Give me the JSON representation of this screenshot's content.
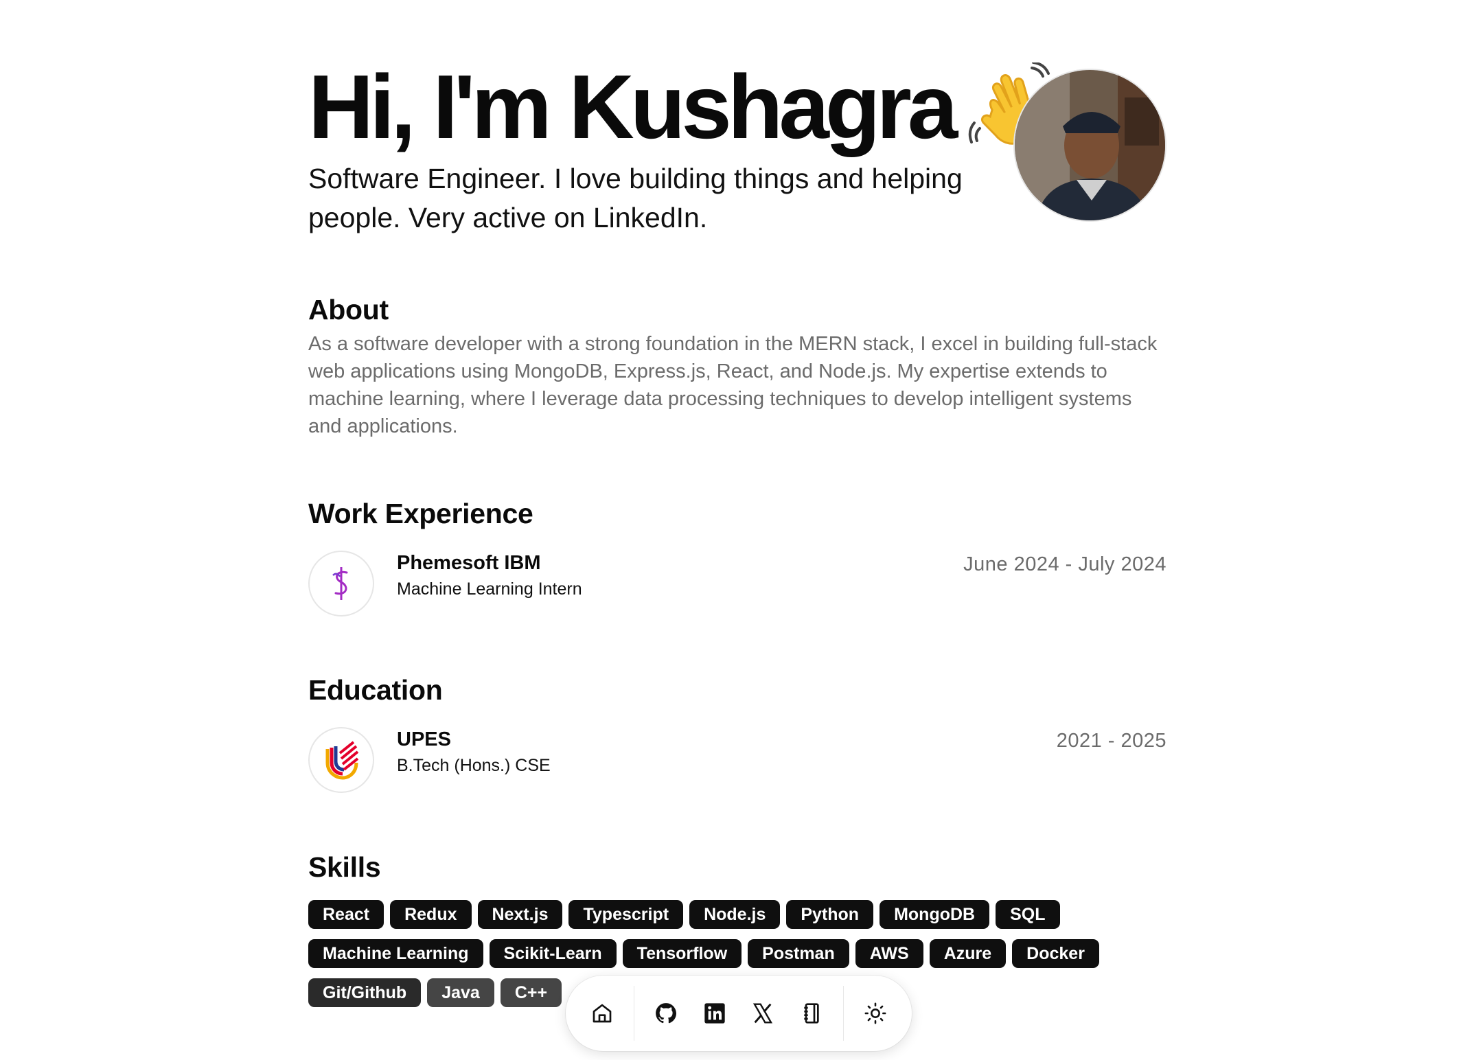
{
  "hero": {
    "title": "Hi, I'm Kushagra",
    "wave_icon": "waving-hand-emoji",
    "subtitle": "Software Engineer. I love building things and helping people. Very active on LinkedIn."
  },
  "about": {
    "heading": "About",
    "text": "As a software developer with a strong foundation in the MERN stack, I excel in building full-stack web applications using MongoDB, Express.js, React, and Node.js. My expertise extends to machine learning, where I leverage data processing techniques to develop intelligent systems and applications."
  },
  "work": {
    "heading": "Work Experience",
    "items": [
      {
        "company": "Phemesoft IBM",
        "role": "Machine Learning Intern",
        "dates": "June 2024 - July 2024",
        "logo": "phemesoft-logo"
      }
    ]
  },
  "education": {
    "heading": "Education",
    "items": [
      {
        "school": "UPES",
        "degree": "B.Tech (Hons.) CSE",
        "dates": "2021 - 2025",
        "logo": "upes-logo"
      }
    ]
  },
  "skills": {
    "heading": "Skills",
    "items": [
      "React",
      "Redux",
      "Next.js",
      "Typescript",
      "Node.js",
      "Python",
      "MongoDB",
      "SQL",
      "Machine Learning",
      "Scikit-Learn",
      "Tensorflow",
      "Postman",
      "AWS",
      "Azure",
      "Docker",
      "Git/Github",
      "Java",
      "C++"
    ]
  },
  "dock": {
    "icons": [
      "home-icon",
      "github-icon",
      "linkedin-icon",
      "x-icon",
      "notebook-icon",
      "sun-icon"
    ]
  },
  "colors": {
    "text": "#0a0a0a",
    "muted": "#6b6b6b",
    "chip": "#0f0f0f"
  }
}
